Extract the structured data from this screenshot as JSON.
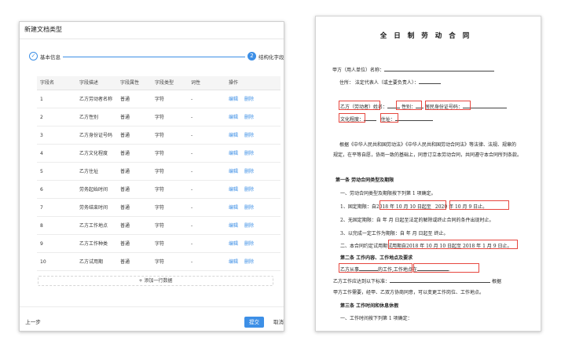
{
  "dialog": {
    "title": "新建文档类型",
    "steps": [
      {
        "index": "✓",
        "label": "基本信息"
      },
      {
        "index": "2",
        "label": "结构化字段"
      }
    ],
    "table": {
      "headers": [
        "字段名",
        "字段描述",
        "字段属性",
        "字段类型",
        "词性",
        "操作"
      ],
      "edit_label": "编辑",
      "delete_label": "删除",
      "rows": [
        [
          "1",
          "乙方劳动者名称",
          "普通",
          "字符",
          "-"
        ],
        [
          "2",
          "乙方性别",
          "普通",
          "字符",
          "-"
        ],
        [
          "3",
          "乙方身份证号码",
          "普通",
          "字符",
          "-"
        ],
        [
          "4",
          "乙方文化程度",
          "普通",
          "字符",
          "-"
        ],
        [
          "5",
          "乙方住址",
          "普通",
          "字符",
          "-"
        ],
        [
          "6",
          "劳务起始时间",
          "普通",
          "字符",
          "-"
        ],
        [
          "7",
          "劳务结束时间",
          "普通",
          "字符",
          "-"
        ],
        [
          "8",
          "乙方工作地点",
          "普通",
          "字符",
          "-"
        ],
        [
          "9",
          "乙方工作种类",
          "普通",
          "字符",
          "-"
        ],
        [
          "10",
          "乙方试用期",
          "普通",
          "字符",
          "-"
        ]
      ]
    },
    "add_row_label": "+ 添加一行数据",
    "prev_label": "上一步",
    "submit_label": "提交",
    "cancel_label": "取消"
  },
  "document": {
    "title": "全日制劳动合同",
    "party_a_name": "甲方（用人单位）名称：",
    "address_rep": "住所：                    法定代表人（或主要负责人）：",
    "party_b_name": "乙方（劳动者）姓名：",
    "gender": "性别：",
    "id_no": "居民身份证号码：",
    "education": "文化程度：",
    "residence": "住址：",
    "para1": "根据《中华人民共和国劳动法》《中华人民共和国劳动合同法》等法律、法规、规章的",
    "para2": "规定，在平等自愿，协商一致的基础上，同意订立本劳动合同，共同遵守本合同所列条款。",
    "sec1": "第一条   劳动合同类型及期限",
    "s1_line1": "一、劳动合同类型及期限按下列第  1   项确定。",
    "s1_fixed_a": "1、固定期限：自",
    "s1_fixed_b": "2018 年  10  月 10  日起至",
    "s1_fixed_c": "2020   年  10  月  9  日止。",
    "s1_open": "2、无固定期限：自    年   月   日起至法定的解除或终止合同的条件出现时止。",
    "s1_task": "3、以完成一定工作为期限：自   年   月   日起至          终止。",
    "s1_prob_a": "二、本合同约定试用期",
    "s1_prob_b": "试用期自2018 年 10 月 10 日起至 2018 年 1 月 9 日止。",
    "sec2": "第二条   工作内容、工作地点及要求",
    "s2_line1a": "乙方从事",
    "s2_line1b": "的工作,工作地点在",
    "s2_line2": "乙方工作应达到以下标准：",
    "s2_line2_end": "根据",
    "s2_line3": "甲方工作需要，经甲、乙双方协商同意，可以变更工作岗位、工作地点。",
    "sec3": "第三条   工作时间和休息休假",
    "s3_line1": "一、工作时间按下列第  1  项确定："
  }
}
